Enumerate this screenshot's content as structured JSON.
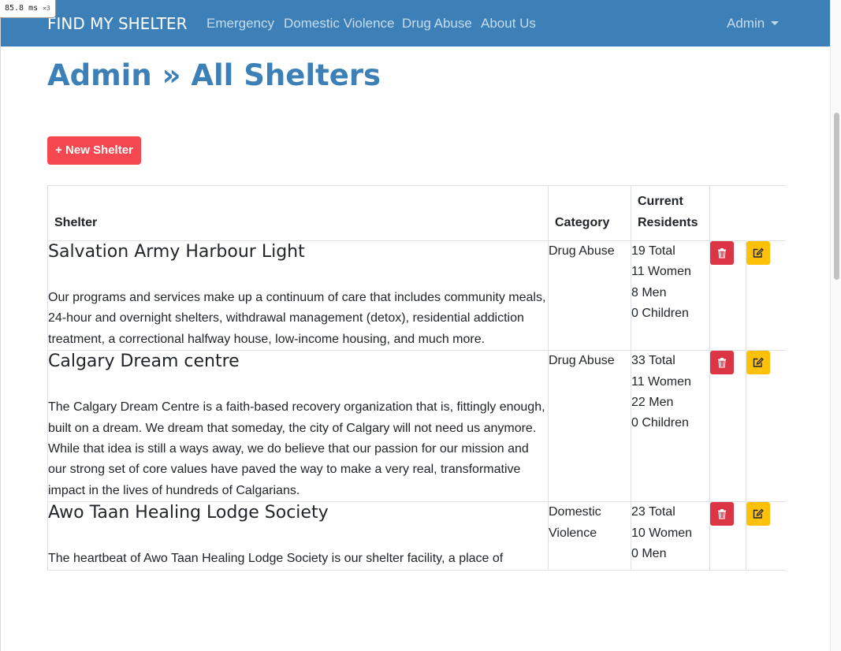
{
  "perf": {
    "value": "85.8",
    "unit": "ms",
    "multiplier": "×3"
  },
  "nav": {
    "brand": "FIND MY SHELTER",
    "links": [
      "Emergency",
      "Domestic Violence",
      "Drug Abuse",
      "About Us"
    ],
    "admin_label": "Admin"
  },
  "page": {
    "title": "Admin » All Shelters",
    "new_button": "+ New Shelter"
  },
  "table": {
    "headers": {
      "shelter": "Shelter",
      "category": "Category",
      "residents_line1": "Current",
      "residents_line2": "Residents"
    },
    "rows": [
      {
        "name": "Salvation Army Harbour Light",
        "description": "Our programs and services make up a continuum of care that includes community meals, 24-hour and overnight shelters, withdrawal management (detox), residential addiction treatment, a correctional halfway house, low-income housing, and much more.",
        "category": "Drug Abuse",
        "residents": [
          "19 Total",
          "11 Women",
          "8 Men",
          "0 Children"
        ]
      },
      {
        "name": "Calgary Dream centre",
        "description": "The Calgary Dream Centre is a faith-based recovery organization that is, fittingly enough, built on a dream. We dream that someday, the city of Calgary will not need us anymore. While that idea is still a ways away, we do believe that our passion for our mission and our strong set of core values have paved the way to make a very real, transformative impact in the lives of hundreds of Calgarians.",
        "category": "Drug Abuse",
        "residents": [
          "33 Total",
          "11 Women",
          "22 Men",
          "0 Children"
        ]
      },
      {
        "name": "Awo Taan Healing Lodge Society",
        "description": "The heartbeat of Awo Taan Healing Lodge Society is our shelter facility, a place of",
        "category": "Domestic Violence",
        "residents": [
          "23 Total",
          "10 Women",
          "0 Men",
          ""
        ]
      }
    ]
  },
  "icons": {
    "delete": "trash-icon",
    "edit": "edit-icon"
  },
  "colors": {
    "navbar": "#3c80b7",
    "title": "#3c80b7",
    "new_button": "#f54850",
    "delete_button": "#dc3545",
    "edit_button": "#ffc107"
  }
}
